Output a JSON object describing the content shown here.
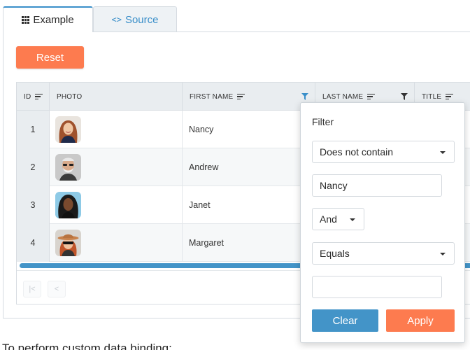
{
  "tabs": [
    {
      "label": "Example",
      "icon": "grid-icon",
      "active": true
    },
    {
      "label": "Source",
      "icon": "code-icon",
      "active": false
    }
  ],
  "reset_label": "Reset",
  "grid": {
    "columns": [
      {
        "label": "ID",
        "sortable": true
      },
      {
        "label": "PHOTO",
        "sortable": false
      },
      {
        "label": "FIRST NAME",
        "sortable": true,
        "filter_icon": "filter-icon"
      },
      {
        "label": "LAST NAME",
        "sortable": true,
        "filter_icon": "filter-icon"
      },
      {
        "label": "TITLE",
        "sortable": true
      }
    ],
    "rows": [
      {
        "id": "1",
        "first_name": "Nancy",
        "avatar": "woman-smiling"
      },
      {
        "id": "2",
        "first_name": "Andrew",
        "avatar": "man-bald"
      },
      {
        "id": "3",
        "first_name": "Janet",
        "avatar": "woman-curly"
      },
      {
        "id": "4",
        "first_name": "Margaret",
        "avatar": "woman-hat"
      }
    ],
    "pager": [
      "first-page-icon",
      "prev-page-icon"
    ]
  },
  "filter": {
    "title": "Filter",
    "operator1": "Does not contain",
    "value1": "Nancy",
    "logic": "And",
    "operator2": "Equals",
    "value2": "",
    "clear_label": "Clear",
    "apply_label": "Apply"
  },
  "below_text": "To perform custom data binding:",
  "colors": {
    "accent": "#3a8fc9",
    "primary": "#fd7b4f",
    "clear": "#4394c8"
  }
}
